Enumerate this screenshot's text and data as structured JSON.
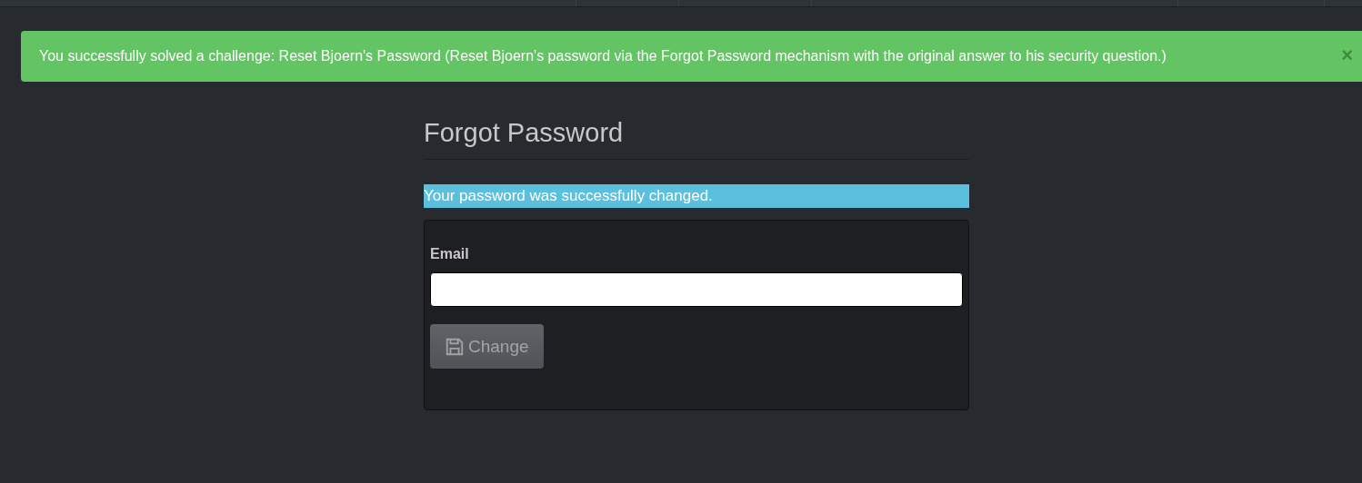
{
  "alert": {
    "message": "You successfully solved a challenge: Reset Bjoern's Password (Reset Bjoern's password via the Forgot Password mechanism with the original answer to his security question.)",
    "close": "×"
  },
  "form": {
    "title": "Forgot Password",
    "info": "Your password was successfully changed.",
    "email": {
      "label": "Email"
    },
    "button": {
      "label": "Change",
      "disabled": true
    }
  }
}
